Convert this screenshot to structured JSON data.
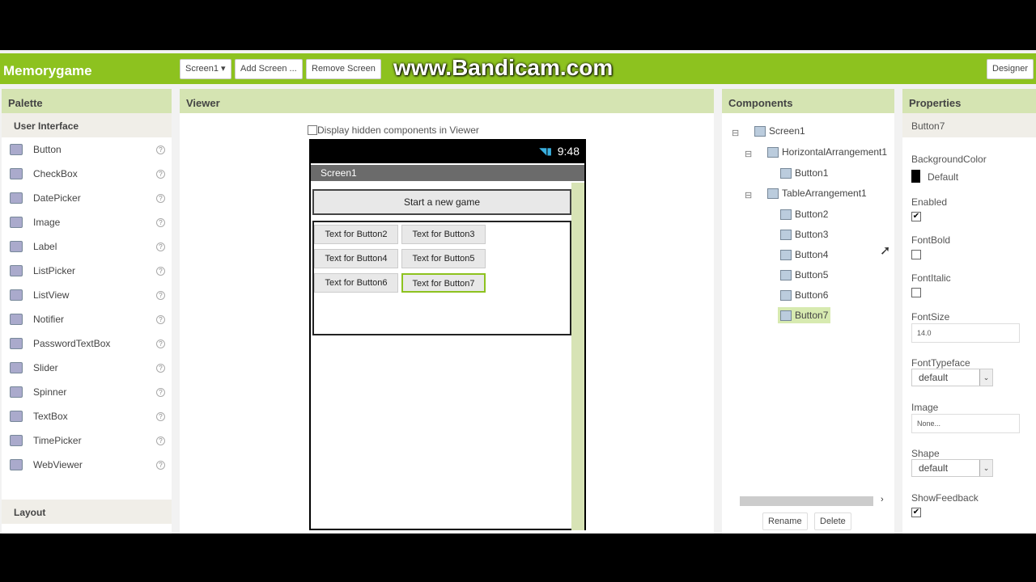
{
  "app_title": "Memorygame",
  "toolbar": {
    "screen_select": "Screen1 ▾",
    "add_screen": "Add Screen ...",
    "remove_screen": "Remove Screen",
    "designer": "Designer"
  },
  "watermark": "www.Bandicam.com",
  "palette": {
    "title": "Palette",
    "section": "User Interface",
    "items": [
      "Button",
      "CheckBox",
      "DatePicker",
      "Image",
      "Label",
      "ListPicker",
      "ListView",
      "Notifier",
      "PasswordTextBox",
      "Slider",
      "Spinner",
      "TextBox",
      "TimePicker",
      "WebViewer"
    ],
    "layout_section": "Layout",
    "help": "?"
  },
  "viewer": {
    "title": "Viewer",
    "hidden_label": "Display hidden components in Viewer",
    "time": "9:48",
    "screen_title": "Screen1",
    "start_button": "Start a new game",
    "buttons": [
      "Text for Button2",
      "Text for Button3",
      "Text for Button4",
      "Text for Button5",
      "Text for Button6",
      "Text for Button7"
    ]
  },
  "components": {
    "title": "Components",
    "tree": [
      "Screen1",
      "HorizontalArrangement1",
      "Button1",
      "TableArrangement1",
      "Button2",
      "Button3",
      "Button4",
      "Button5",
      "Button6",
      "Button7"
    ],
    "toggle": "⊟",
    "rename": "Rename",
    "delete": "Delete"
  },
  "properties": {
    "title": "Properties",
    "component": "Button7",
    "bg_label": "BackgroundColor",
    "bg_value": "Default",
    "enabled_label": "Enabled",
    "fontbold_label": "FontBold",
    "fontitalic_label": "FontItalic",
    "fontsize_label": "FontSize",
    "fontsize_value": "14.0",
    "typeface_label": "FontTypeface",
    "typeface_value": "default",
    "image_label": "Image",
    "image_value": "None...",
    "shape_label": "Shape",
    "shape_value": "default",
    "feedback_label": "ShowFeedback",
    "check": "✔",
    "arrow": "⌄"
  },
  "colors": {
    "accent": "#8dc21f",
    "panel_header": "#d5e4b2",
    "selected": "#d7eab0"
  }
}
